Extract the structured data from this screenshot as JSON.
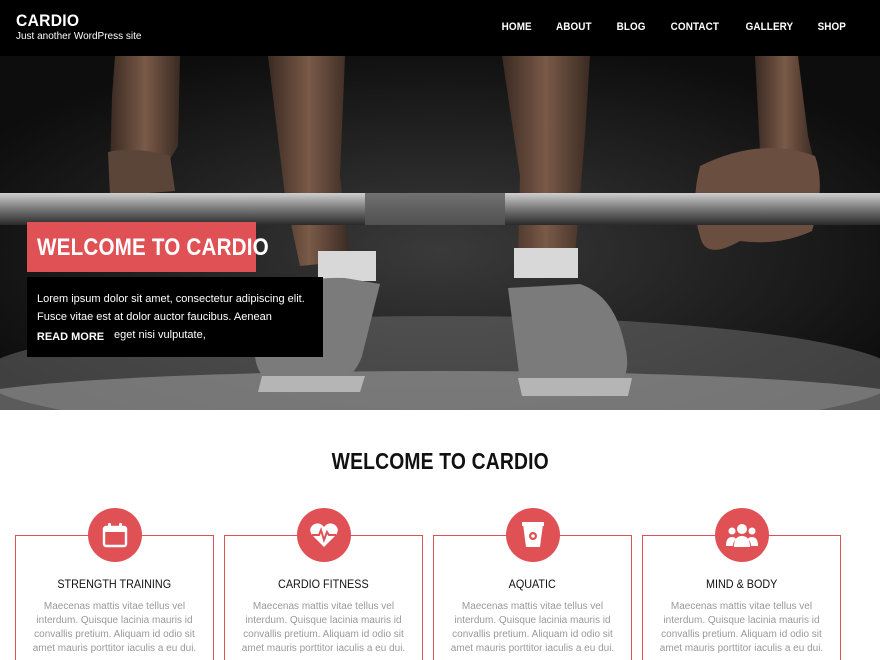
{
  "site": {
    "title": "CARDIO",
    "tagline": "Just another WordPress site"
  },
  "nav": {
    "items": [
      {
        "label": "HOME"
      },
      {
        "label": "ABOUT"
      },
      {
        "label": "BLOG"
      },
      {
        "label": "CONTACT"
      },
      {
        "label": "GALLERY"
      },
      {
        "label": "SHOP"
      }
    ]
  },
  "hero": {
    "title": "WELCOME TO CARDIO",
    "text": "Lorem ipsum dolor sit amet, consectetur adipiscing elit. Fusce vitae est at dolor auctor faucibus. Aenean hendrerit lorem eget nisi vulputate,",
    "button_label": "READ MORE"
  },
  "section": {
    "heading": "WELCOME TO CARDIO"
  },
  "features": [
    {
      "title": "STRENGTH TRAINING",
      "icon": "calendar-icon",
      "text": "Maecenas mattis vitae tellus vel interdum. Quisque lacinia mauris id convallis pretium. Aliquam id odio sit amet mauris porttitor iaculis a eu dui."
    },
    {
      "title": "CARDIO FITNESS",
      "icon": "heartbeat-icon",
      "text": "Maecenas mattis vitae tellus vel interdum. Quisque lacinia mauris id convallis pretium. Aliquam id odio sit amet mauris porttitor iaculis a eu dui."
    },
    {
      "title": "AQUATIC",
      "icon": "cup-icon",
      "text": "Maecenas mattis vitae tellus vel interdum. Quisque lacinia mauris id convallis pretium. Aliquam id odio sit amet mauris porttitor iaculis a eu dui."
    },
    {
      "title": "MIND & BODY",
      "icon": "users-icon",
      "text": "Maecenas mattis vitae tellus vel interdum. Quisque lacinia mauris id convallis pretium. Aliquam id odio sit amet mauris porttitor iaculis a eu dui."
    }
  ],
  "colors": {
    "accent": "#e05156",
    "header_bg": "#000000"
  }
}
